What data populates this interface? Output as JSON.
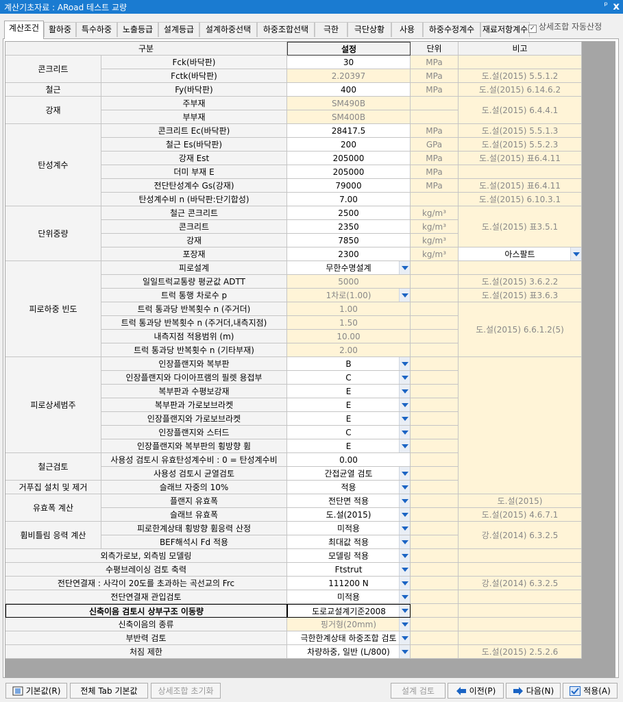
{
  "window": {
    "title": "계산기초자료 : ARoad 테스트 교량",
    "pin_glyph": "ᵖ",
    "close_glyph": "x"
  },
  "tabs": [
    "계산조건",
    "활하중",
    "특수하중",
    "노출등급",
    "설계등급",
    "설계하중선택",
    "하중조합선택",
    "극한",
    "극단상황",
    "사용",
    "하중수정계수",
    "재료저항계수"
  ],
  "detail_checkbox": {
    "label": "상세조합 자동산정",
    "checked": true
  },
  "columns": {
    "category": "구분",
    "setting": "설정",
    "unit": "단위",
    "note": "비고"
  },
  "groups": [
    "콘크리트",
    "철근",
    "강재",
    "탄성계수",
    "단위중량",
    "피로하중 빈도",
    "피로상세범주",
    "철근검토",
    "거푸집 설치 및 제거",
    "유효폭 계산",
    "휨비틀림 응력 계산"
  ],
  "rows": [
    {
      "label": "Fck(바닥판)",
      "value": "30",
      "unit": "MPa"
    },
    {
      "label": "Fctk(바닥판)",
      "value": "2.20397",
      "unit": "MPa",
      "note": "도.설(2015) 5.5.1.2"
    },
    {
      "label": "Fy(바닥판)",
      "value": "400",
      "unit": "MPa",
      "note": "도.설(2015) 6.14.6.2"
    },
    {
      "label": "주부재",
      "value": "SM490B",
      "note": "도.설(2015) 6.4.4.1"
    },
    {
      "label": "부부재",
      "value": "SM400B"
    },
    {
      "label": "콘크리트 Ec(바닥판)",
      "value": "28417.5",
      "unit": "MPa",
      "note": "도.설(2015) 5.5.1.3"
    },
    {
      "label": "철근 Es(바닥판)",
      "value": "200",
      "unit": "GPa",
      "note": "도.설(2015) 5.5.2.3"
    },
    {
      "label": "강재 Est",
      "value": "205000",
      "unit": "MPa",
      "note": "도.설(2015) 표6.4.11"
    },
    {
      "label": "더미 부재 E",
      "value": "205000",
      "unit": "MPa"
    },
    {
      "label": "전단탄성계수 Gs(강재)",
      "value": "79000",
      "unit": "MPa",
      "note": "도.설(2015) 표6.4.11"
    },
    {
      "label": "탄성계수비 n (바닥판:단기합성)",
      "value": "7.00",
      "note": "도.설(2015) 6.10.3.1"
    },
    {
      "label": "철근 콘크리트",
      "value": "2500",
      "unit": "kg/m³",
      "note": "도.설(2015) 표3.5.1"
    },
    {
      "label": "콘크리트",
      "value": "2350",
      "unit": "kg/m³"
    },
    {
      "label": "강재",
      "value": "7850",
      "unit": "kg/m³"
    },
    {
      "label": "포장재",
      "value": "2300",
      "unit": "kg/m³",
      "note": "아스팔트"
    },
    {
      "label": "피로설계",
      "value": "무한수명설계"
    },
    {
      "label": "일일트럭교통량 평균값 ADTT",
      "value": "5000",
      "note": "도.설(2015) 3.6.2.2"
    },
    {
      "label": "트럭 통행 차로수 p",
      "value": "1차로(1.00)",
      "note": "도.설(2015) 표3.6.3"
    },
    {
      "label": "트럭 통과당 반복횟수 n (주거더)",
      "value": "1.00",
      "note": "도.설(2015) 6.6.1.2(5)"
    },
    {
      "label": "트럭 통과당 반복횟수 n (주거더,내측지점)",
      "value": "1.50"
    },
    {
      "label": "내측지점 적용범위 (m)",
      "value": "10.00"
    },
    {
      "label": "트럭 통과당 반복횟수 n (기타부재)",
      "value": "2.00"
    },
    {
      "label": "인장플랜지와 복부판",
      "value": "B"
    },
    {
      "label": "인장플랜지와 다이아프램의 필렛 용접부",
      "value": "C"
    },
    {
      "label": "복부판과 수평보강재",
      "value": "E"
    },
    {
      "label": "복부판과 가로보브라켓",
      "value": "E"
    },
    {
      "label": "인장플랜지와 가로보브라켓",
      "value": "E"
    },
    {
      "label": "인장플랜지와 스터드",
      "value": "C"
    },
    {
      "label": "인장플랜지와 복부판의 횡방향 휨",
      "value": "E"
    },
    {
      "label": "사용성 검토시 유효탄성계수비 : 0 = 탄성계수비",
      "value": "0.00"
    },
    {
      "label": "사용성 검토시 균열검토",
      "value": "간접균열 검토"
    },
    {
      "label": "슬래브 자중의 10%",
      "value": "적용"
    },
    {
      "label": "플랜지 유효폭",
      "value": "전단면 적용",
      "note": "도.설(2015)"
    },
    {
      "label": "슬래브 유효폭",
      "value": "도.설(2015)",
      "note": "도.설(2015) 4.6.7.1"
    },
    {
      "label": "피로한계상태 횡방향 휨응력 산정",
      "value": "미적용",
      "note": "강.설(2014) 6.3.2.5"
    },
    {
      "label": "BEF해석시 Fd 적용",
      "value": "최대값 적용"
    },
    {
      "label": "외측가로보, 외측빔 모델링",
      "value": "모델링 적용"
    },
    {
      "label": "수평브레이싱 검토 축력",
      "value": "Ftstrut"
    },
    {
      "label": "전단연결재 : 사각이 20도를 초과하는 곡선교의 Frc",
      "value": "111200 N",
      "note": "강.설(2014) 6.3.2.5"
    },
    {
      "label": "전단연결재 관입검토",
      "value": "미적용"
    },
    {
      "label": "신축이음 검토시 상부구조 이동량",
      "value": "도로교설계기준2008"
    },
    {
      "label": "신축이음의 종류",
      "value": "핑거형(20mm)"
    },
    {
      "label": "부반력 검토",
      "value": "극한한계상태 하중조합 검토"
    },
    {
      "label": "처짐 제한",
      "value": "차량하중, 일반 (L/800)",
      "note": "도.설(2015) 2.5.2.6"
    }
  ],
  "buttons": {
    "default": "기본값(R)",
    "all_tab_default": "전체 Tab 기본값",
    "reset_detail": "상세조합 초기화",
    "design_check": "설계 검토",
    "prev": "이전(P)",
    "next": "다음(N)",
    "apply": "적용(A)"
  }
}
